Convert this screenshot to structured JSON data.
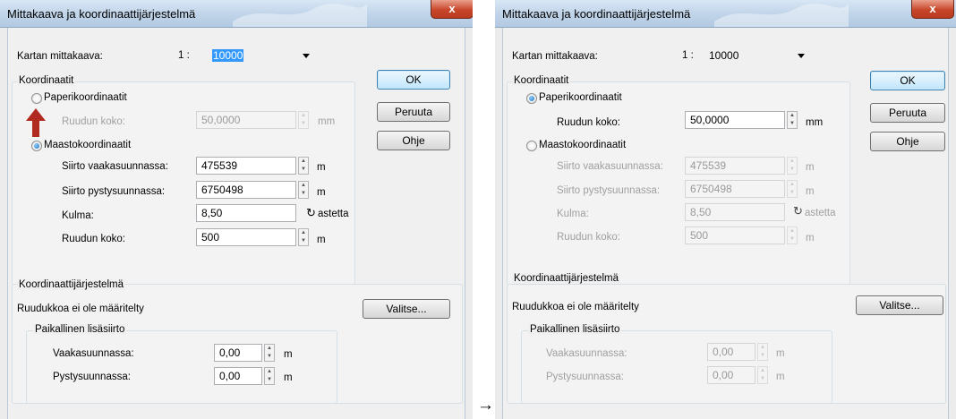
{
  "dialogs": [
    {
      "title": "Mittakaava ja koordinaattijärjestelmä",
      "close_glyph": "x",
      "scale_label": "Kartan mittakaava:",
      "scale_prefix": "1 :",
      "scale_value": "10000",
      "coords_group": "Koordinaatit",
      "paper_radio": "Paperikoordinaatit",
      "paper_cell_label": "Ruudun koko:",
      "paper_cell_value": "50,0000",
      "paper_cell_unit": "mm",
      "terrain_radio": "Maastokoordinaatit",
      "rows": [
        {
          "label": "Siirto vaakasuunnassa:",
          "value": "475539",
          "unit": "m"
        },
        {
          "label": "Siirto pystysuunnassa:",
          "value": "6750498",
          "unit": "m"
        },
        {
          "label": "Kulma:",
          "value": "8,50",
          "unit": "astetta"
        },
        {
          "label": "Ruudun koko:",
          "value": "500",
          "unit": "m"
        }
      ],
      "ok": "OK",
      "cancel": "Peruuta",
      "help": "Ohje",
      "crs_group": "Koordinaattijärjestelmä",
      "crs_status": "Ruudukkoa ei ole määritelty",
      "choose": "Valitse...",
      "local_group": "Paikallinen lisäsiirto",
      "local_rows": [
        {
          "label": "Vaakasuunnassa:",
          "value": "0,00",
          "unit": "m"
        },
        {
          "label": "Pystysuunnassa:",
          "value": "0,00",
          "unit": "m"
        }
      ]
    },
    {
      "title": "Mittakaava ja koordinaattijärjestelmä",
      "close_glyph": "x",
      "scale_label": "Kartan mittakaava:",
      "scale_prefix": "1 :",
      "scale_value": "10000",
      "coords_group": "Koordinaatit",
      "paper_radio": "Paperikoordinaatit",
      "paper_cell_label": "Ruudun koko:",
      "paper_cell_value": "50,0000",
      "paper_cell_unit": "mm",
      "terrain_radio": "Maastokoordinaatit",
      "rows": [
        {
          "label": "Siirto vaakasuunnassa:",
          "value": "475539",
          "unit": "m"
        },
        {
          "label": "Siirto pystysuunnassa:",
          "value": "6750498",
          "unit": "m"
        },
        {
          "label": "Kulma:",
          "value": "8,50",
          "unit": "astetta"
        },
        {
          "label": "Ruudun koko:",
          "value": "500",
          "unit": "m"
        }
      ],
      "ok": "OK",
      "cancel": "Peruuta",
      "help": "Ohje",
      "crs_group": "Koordinaattijärjestelmä",
      "crs_status": "Ruudukkoa ei ole määritelty",
      "choose": "Valitse...",
      "local_group": "Paikallinen lisäsiirto",
      "local_rows": [
        {
          "label": "Vaakasuunnassa:",
          "value": "0,00",
          "unit": "m"
        },
        {
          "label": "Pystysuunnassa:",
          "value": "0,00",
          "unit": "m"
        }
      ]
    }
  ],
  "between_arrow": "→",
  "state": {
    "left_selected": "Maastokoordinaatit",
    "right_selected": "Paperikoordinaatit"
  },
  "colors": {
    "titlebar": "#c3d6ea",
    "selection": "#3399ff",
    "callout_arrow": "#b02a20",
    "close_button": "#c8472b"
  },
  "icons": {
    "rotate": "rotate-icon",
    "callout": "arrow-up-icon",
    "dropdown": "chevron-down-icon",
    "spinner": "spin-updown-icon"
  }
}
